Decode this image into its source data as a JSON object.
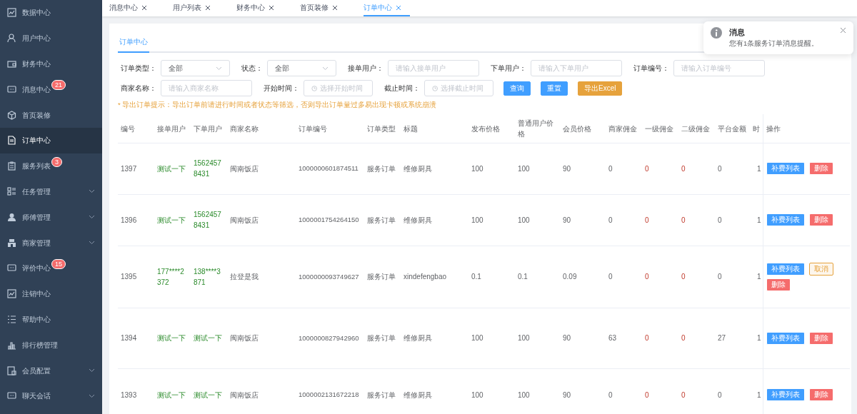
{
  "sidebar": {
    "items": [
      {
        "label": "数据中心",
        "kind": "link",
        "selected": false
      },
      {
        "label": "用户中心",
        "kind": "link",
        "selected": false
      },
      {
        "label": "财务中心",
        "kind": "link",
        "selected": false
      },
      {
        "label": "消息中心",
        "kind": "link",
        "selected": false,
        "badge": "21"
      },
      {
        "label": "首页装修",
        "kind": "link",
        "selected": false
      },
      {
        "label": "订单中心",
        "kind": "link",
        "selected": true
      },
      {
        "label": "服务列表",
        "kind": "link",
        "selected": false,
        "badge": "3"
      },
      {
        "label": "任务管理",
        "kind": "group",
        "selected": false
      },
      {
        "label": "师傅管理",
        "kind": "group",
        "selected": false
      },
      {
        "label": "商家管理",
        "kind": "group",
        "selected": false
      },
      {
        "label": "评价中心",
        "kind": "link",
        "selected": false,
        "badge": "15"
      },
      {
        "label": "注销中心",
        "kind": "link",
        "selected": false
      },
      {
        "label": "帮助中心",
        "kind": "link",
        "selected": false
      },
      {
        "label": "排行榜管理",
        "kind": "link",
        "selected": false
      },
      {
        "label": "会员配置",
        "kind": "group",
        "selected": false
      },
      {
        "label": "聊天会话",
        "kind": "group",
        "selected": false
      }
    ]
  },
  "tabs": [
    {
      "label": "消息中心",
      "selected": false
    },
    {
      "label": "用户列表",
      "selected": false
    },
    {
      "label": "财务中心",
      "selected": false
    },
    {
      "label": "首页装修",
      "selected": false
    },
    {
      "label": "订单中心",
      "selected": true
    }
  ],
  "page_tab": {
    "label": "订单中心",
    "selected": true
  },
  "filters": [
    {
      "label": "订单类型：",
      "kind": "select",
      "value": "全部"
    },
    {
      "label": "状态：",
      "kind": "select",
      "value": "全部"
    },
    {
      "label": "接单用户：",
      "kind": "text",
      "placeholder": "请输入接单用户"
    },
    {
      "label": "下单用户：",
      "kind": "text",
      "placeholder": "请输入下单用户"
    },
    {
      "label": "订单编号：",
      "kind": "text",
      "placeholder": "请输入订单编号"
    },
    {
      "label": "商家名称：",
      "kind": "text",
      "placeholder": "请输入商家名称"
    },
    {
      "label": "开始时间：",
      "kind": "date",
      "placeholder": "选择开始时间"
    },
    {
      "label": "截止时间：",
      "kind": "date",
      "placeholder": "选择截止时间"
    }
  ],
  "filter_buttons": [
    {
      "label": "查询",
      "kind": "primary"
    },
    {
      "label": "重置",
      "kind": "primary"
    },
    {
      "label": "导出Excel",
      "kind": "warning"
    }
  ],
  "hint": "* 导出订单提示：导出订单前请进行时间或者状态等筛选，否则导出订单量过多易出现卡顿或系统崩溃",
  "table": {
    "columns": [
      {
        "label": "编号",
        "kind": "plain"
      },
      {
        "label": "接单用户",
        "kind": "user"
      },
      {
        "label": "下单用户",
        "kind": "user"
      },
      {
        "label": "商家名称",
        "kind": "plain"
      },
      {
        "label": "订单编号",
        "kind": "plain"
      },
      {
        "label": "订单类型",
        "kind": "plain"
      },
      {
        "label": "标题",
        "kind": "plain"
      },
      {
        "label": "发布价格",
        "kind": "plain"
      },
      {
        "label": "普通用户价格",
        "kind": "plain"
      },
      {
        "label": "会员价格",
        "kind": "plain"
      },
      {
        "label": "商家佣金",
        "kind": "plain"
      },
      {
        "label": "一级佣金",
        "kind": "commission"
      },
      {
        "label": "二级佣金",
        "kind": "commission"
      },
      {
        "label": "平台金额",
        "kind": "plain"
      },
      {
        "label": "时",
        "kind": "plain"
      }
    ],
    "action_column": "操作",
    "rows": [
      {
        "cells": [
          "1397",
          "测试一下",
          "15624578431",
          "闽南饭店",
          "1000000601874511",
          "服务订单",
          "维修厨具",
          "100",
          "100",
          "90",
          "0",
          "0",
          "0",
          "0",
          "1"
        ],
        "actions": [
          {
            "label": "补费列表",
            "kind": "primary"
          },
          {
            "label": "删除",
            "kind": "danger"
          }
        ]
      },
      {
        "cells": [
          "1396",
          "测试一下",
          "15624578431",
          "闽南饭店",
          "1000001754264150",
          "服务订单",
          "维修厨具",
          "100",
          "100",
          "90",
          "0",
          "0",
          "0",
          "0",
          "1"
        ],
        "actions": [
          {
            "label": "补费列表",
            "kind": "primary"
          },
          {
            "label": "删除",
            "kind": "danger"
          }
        ]
      },
      {
        "cells": [
          "1395",
          "177****2372",
          "138****3871",
          "拉登是我",
          "1000000093749627",
          "服务订单",
          "xindefengbao",
          "0.1",
          "0.1",
          "0.09",
          "0",
          "0",
          "0",
          "0",
          "1"
        ],
        "actions": [
          {
            "label": "补费列表",
            "kind": "primary"
          },
          {
            "label": "取消",
            "kind": "warning-plain"
          },
          {
            "label": "删除",
            "kind": "danger"
          }
        ]
      },
      {
        "cells": [
          "1394",
          "测试一下",
          "测试一下",
          "闽南饭店",
          "1000000827942960",
          "服务订单",
          "维修厨具",
          "100",
          "100",
          "90",
          "63",
          "0",
          "0",
          "27",
          "1"
        ],
        "actions": [
          {
            "label": "补费列表",
            "kind": "primary"
          },
          {
            "label": "删除",
            "kind": "danger"
          }
        ]
      },
      {
        "cells": [
          "1393",
          "测试一下",
          "测试一下",
          "闽南饭店",
          "1000002131672218",
          "服务订单",
          "维修厨具",
          "100",
          "100",
          "90",
          "0",
          "0",
          "0",
          "0",
          "1"
        ],
        "actions": [
          {
            "label": "补费列表",
            "kind": "primary"
          },
          {
            "label": "删除",
            "kind": "danger"
          }
        ]
      }
    ]
  },
  "notification": {
    "title": "消息",
    "message": "您有1条服务订单消息提醒。"
  }
}
